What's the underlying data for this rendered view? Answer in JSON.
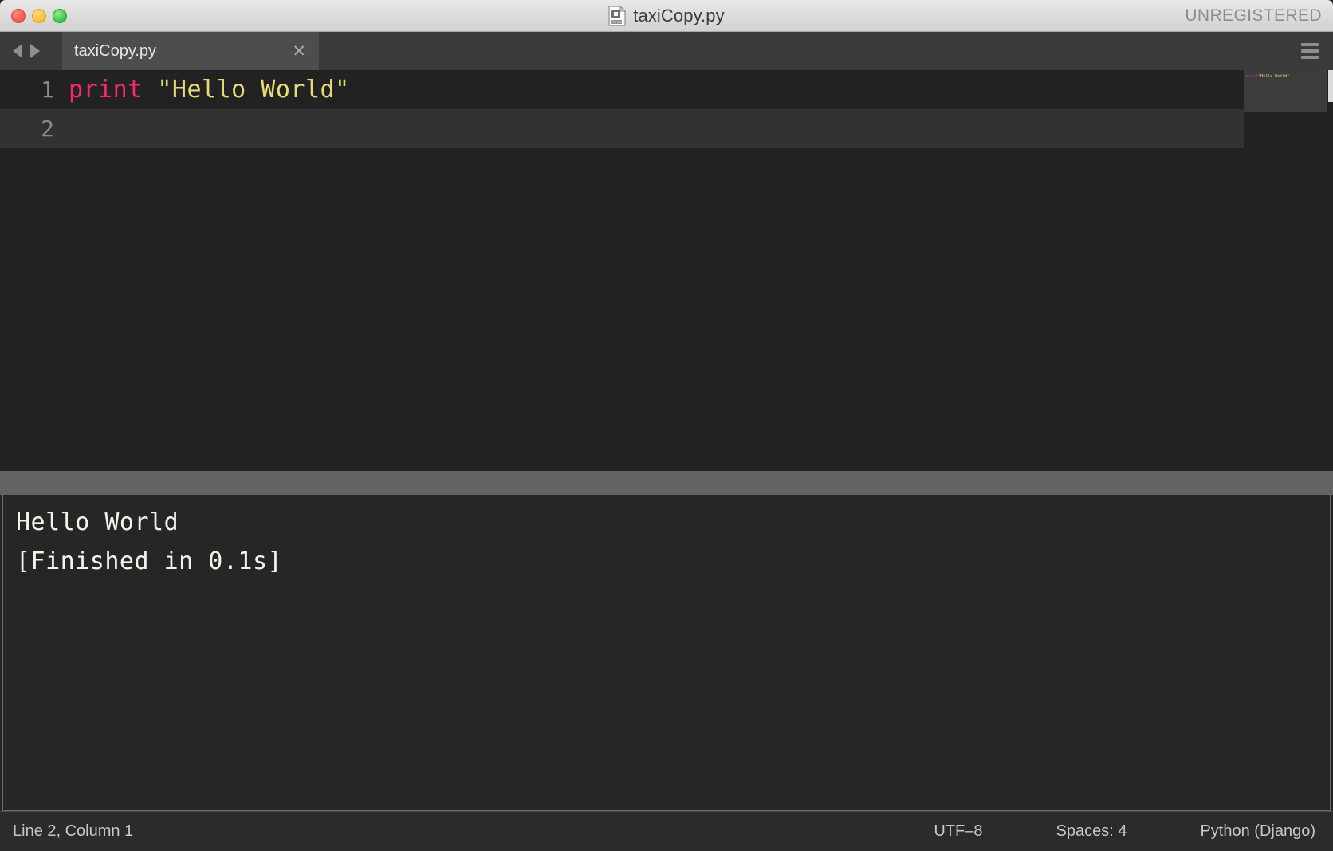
{
  "window": {
    "title": "taxiCopy.py",
    "title_icon": "python-file-icon",
    "license_badge": "UNREGISTERED",
    "traffic_lights": {
      "close": "close-window-button",
      "minimize": "minimize-window-button",
      "maximize": "maximize-window-button"
    }
  },
  "tabbar": {
    "nav_back": "nav-back-arrow",
    "nav_forward": "nav-forward-arrow",
    "menu_icon": "hamburger-menu-icon",
    "tabs": [
      {
        "label": "taxiCopy.py",
        "close_glyph": "✕",
        "active": true
      }
    ]
  },
  "editor": {
    "lines": [
      {
        "number": "1",
        "keyword": "print",
        "space": " ",
        "string": "\"Hello World\"",
        "highlighted": false
      },
      {
        "number": "2",
        "keyword": "",
        "space": "",
        "string": "",
        "highlighted": true
      }
    ],
    "minimap_text": "print \"Hello World\""
  },
  "console": {
    "lines": [
      "Hello World",
      "[Finished in 0.1s]"
    ]
  },
  "statusbar": {
    "cursor_position": "Line 2, Column 1",
    "encoding": "UTF–8",
    "indentation": "Spaces: 4",
    "syntax": "Python (Django)"
  },
  "colors": {
    "keyword": "#f92672",
    "string": "#e6db74",
    "editor_bg": "#222222",
    "console_bg": "#262626",
    "line_highlight": "#323232",
    "tab_active": "#4d4d4d",
    "tabbar_bg": "#3a3a3a",
    "statusbar_bg": "#2b2b2b",
    "divider": "#636363",
    "console_text": "#f5f2e8",
    "gutter_text": "#8b8b8b"
  }
}
